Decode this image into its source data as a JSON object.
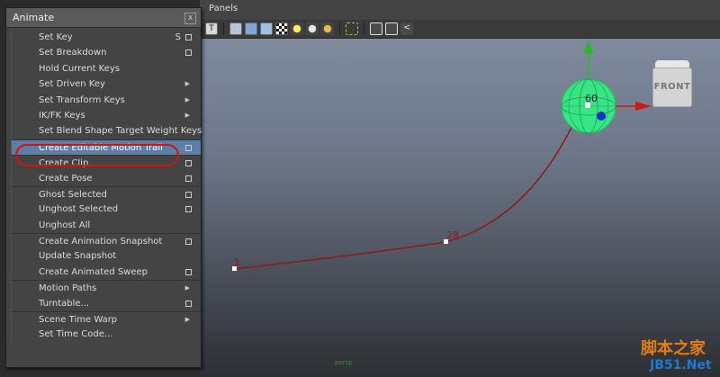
{
  "viewport": {
    "menu_panels": "Panels",
    "toolbar_icons": [
      "text-icon",
      "wireframe-icon",
      "shaded-cube-icon",
      "textured-cube-icon",
      "checker-icon",
      "light-yellow-icon",
      "light-grey-icon",
      "light-gold-icon",
      "select-box-icon",
      "cube-outline-icon",
      "isolate-icon",
      "share-icon"
    ],
    "frame_labels": {
      "start": "1",
      "mid": "28",
      "end": "60"
    },
    "view_cube_label": "FRONT",
    "bottom_label": "persp",
    "watermark_main": "脚本之家",
    "watermark_sub": "JB51.Net",
    "colors": {
      "trail": "#8b1a1a",
      "manip_green": "#2cd878",
      "x_axis": "#cc1a1a",
      "y_axis": "#1fbf1f",
      "z_axis": "#1a2ecc"
    }
  },
  "menu": {
    "title": "Animate",
    "close_label": "x",
    "items": [
      {
        "label": "Set Key",
        "hotkey": "S",
        "option": true,
        "submenu": false,
        "sep": false,
        "highlight": false
      },
      {
        "label": "Set Breakdown",
        "hotkey": "",
        "option": true,
        "submenu": false,
        "sep": false,
        "highlight": false
      },
      {
        "label": "Hold Current Keys",
        "hotkey": "",
        "option": false,
        "submenu": false,
        "sep": false,
        "highlight": false
      },
      {
        "label": "Set Driven Key",
        "hotkey": "",
        "option": false,
        "submenu": true,
        "sep": false,
        "highlight": false
      },
      {
        "label": "Set Transform Keys",
        "hotkey": "",
        "option": false,
        "submenu": true,
        "sep": false,
        "highlight": false
      },
      {
        "label": "IK/FK Keys",
        "hotkey": "",
        "option": false,
        "submenu": true,
        "sep": false,
        "highlight": false
      },
      {
        "label": "Set Blend Shape Target Weight Keys",
        "hotkey": "",
        "option": false,
        "submenu": false,
        "sep": false,
        "highlight": false
      },
      {
        "label": "Create Editable Motion Trail",
        "hotkey": "",
        "option": true,
        "submenu": false,
        "sep": true,
        "highlight": true
      },
      {
        "label": "Create Clip",
        "hotkey": "",
        "option": true,
        "submenu": false,
        "sep": true,
        "highlight": false
      },
      {
        "label": "Create Pose",
        "hotkey": "",
        "option": true,
        "submenu": false,
        "sep": false,
        "highlight": false
      },
      {
        "label": "Ghost Selected",
        "hotkey": "",
        "option": true,
        "submenu": false,
        "sep": true,
        "highlight": false
      },
      {
        "label": "Unghost Selected",
        "hotkey": "",
        "option": true,
        "submenu": false,
        "sep": false,
        "highlight": false
      },
      {
        "label": "Unghost All",
        "hotkey": "",
        "option": false,
        "submenu": false,
        "sep": false,
        "highlight": false
      },
      {
        "label": "Create Animation Snapshot",
        "hotkey": "",
        "option": true,
        "submenu": false,
        "sep": true,
        "highlight": false
      },
      {
        "label": "Update Snapshot",
        "hotkey": "",
        "option": false,
        "submenu": false,
        "sep": false,
        "highlight": false
      },
      {
        "label": "Create Animated Sweep",
        "hotkey": "",
        "option": true,
        "submenu": false,
        "sep": false,
        "highlight": false
      },
      {
        "label": "Motion Paths",
        "hotkey": "",
        "option": false,
        "submenu": true,
        "sep": true,
        "highlight": false
      },
      {
        "label": "Turntable...",
        "hotkey": "",
        "option": true,
        "submenu": false,
        "sep": false,
        "highlight": false
      },
      {
        "label": "Scene Time Warp",
        "hotkey": "",
        "option": false,
        "submenu": true,
        "sep": true,
        "highlight": false
      },
      {
        "label": "Set Time Code...",
        "hotkey": "",
        "option": false,
        "submenu": false,
        "sep": false,
        "highlight": false
      }
    ]
  }
}
